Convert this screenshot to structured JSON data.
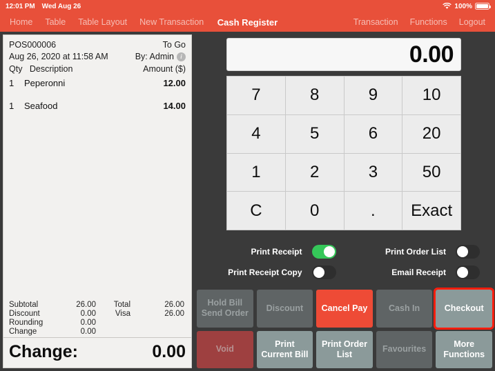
{
  "statusbar": {
    "time": "12:01 PM",
    "date": "Wed Aug 26",
    "battery_percent": "100%",
    "wifi_icon": "wifi-icon",
    "battery_icon": "battery-full-icon"
  },
  "navbar": {
    "title": "Cash Register",
    "left_items": [
      {
        "label": "Home"
      },
      {
        "label": "Table"
      },
      {
        "label": "Table Layout"
      },
      {
        "label": "New Transaction"
      }
    ],
    "right_items": [
      {
        "label": "Transaction"
      },
      {
        "label": "Functions"
      },
      {
        "label": "Logout"
      }
    ]
  },
  "receipt": {
    "order_id": "POS000006",
    "order_type": "To Go",
    "datetime": "Aug 26, 2020 at 11:58 AM",
    "cashier": "By: Admin",
    "info_icon": "info-circle-icon",
    "columns": {
      "qty": "Qty",
      "description": "Description",
      "amount": "Amount ($)"
    },
    "items": [
      {
        "qty": "1",
        "description": "Peperonni",
        "amount": "12.00"
      },
      {
        "qty": "1",
        "description": "Seafood",
        "amount": "14.00"
      }
    ],
    "totals": [
      {
        "label": "Subtotal",
        "value": "26.00",
        "label2": "Total",
        "value2": "26.00"
      },
      {
        "label": "Discount",
        "value": "0.00",
        "label2": "Visa",
        "value2": "26.00"
      },
      {
        "label": "Rounding",
        "value": "0.00",
        "label2": "",
        "value2": ""
      },
      {
        "label": "Change",
        "value": "0.00",
        "label2": "",
        "value2": ""
      }
    ],
    "change_label": "Change:",
    "change_value": "0.00"
  },
  "display": {
    "amount": "0.00"
  },
  "keypad": {
    "keys": [
      {
        "label": "7"
      },
      {
        "label": "8"
      },
      {
        "label": "9"
      },
      {
        "label": "10"
      },
      {
        "label": "4"
      },
      {
        "label": "5"
      },
      {
        "label": "6"
      },
      {
        "label": "20"
      },
      {
        "label": "1"
      },
      {
        "label": "2"
      },
      {
        "label": "3"
      },
      {
        "label": "50"
      },
      {
        "label": "C"
      },
      {
        "label": "0"
      },
      {
        "label": "."
      },
      {
        "label": "Exact"
      }
    ]
  },
  "toggles": [
    {
      "label": "Print Receipt",
      "state": "on"
    },
    {
      "label": "Print Order List",
      "state": "off"
    },
    {
      "label": "Print Receipt Copy",
      "state": "off"
    },
    {
      "label": "Email Receipt",
      "state": "off"
    }
  ],
  "actions": [
    {
      "label": "Hold Bill\nSend Order",
      "style": "disabled",
      "selected": false
    },
    {
      "label": "Discount",
      "style": "disabled",
      "selected": false
    },
    {
      "label": "Cancel Pay",
      "style": "danger",
      "selected": false
    },
    {
      "label": "Cash In",
      "style": "disabled",
      "selected": false
    },
    {
      "label": "Checkout",
      "style": "enabled",
      "selected": true
    },
    {
      "label": "Void",
      "style": "void",
      "selected": false
    },
    {
      "label": "Print\nCurrent Bill",
      "style": "enabled",
      "selected": false
    },
    {
      "label": "Print Order\nList",
      "style": "enabled",
      "selected": false
    },
    {
      "label": "Favourites",
      "style": "disabled",
      "selected": false
    },
    {
      "label": "More\nFunctions",
      "style": "enabled",
      "selected": false
    }
  ],
  "colors": {
    "brand_red": "#e8503a",
    "danger_red": "#ee4b36",
    "selection_red": "#ff1d0d",
    "toggle_green": "#35c759",
    "enabled_gray": "#8b9a9a",
    "disabled_gray": "#5f6465",
    "void_red": "#9e4040",
    "background": "#3a3a3a",
    "receipt_bg": "#f2f1ef"
  }
}
